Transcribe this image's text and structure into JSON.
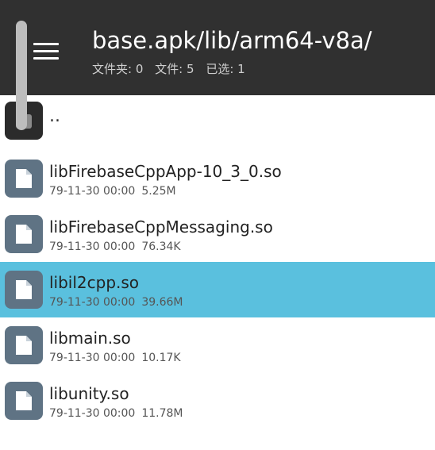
{
  "header": {
    "path": "base.apk/lib/arm64-v8a/",
    "folders_label": "文件夹: 0",
    "files_label": "文件: 5",
    "selected_label": "已选: 1"
  },
  "parent_dir": {
    "name": ".."
  },
  "files": [
    {
      "name": "libFirebaseCppApp-10_3_0.so",
      "date": "79-11-30 00:00",
      "size": "5.25M",
      "selected": false
    },
    {
      "name": "libFirebaseCppMessaging.so",
      "date": "79-11-30 00:00",
      "size": "76.34K",
      "selected": false
    },
    {
      "name": "libil2cpp.so",
      "date": "79-11-30 00:00",
      "size": "39.66M",
      "selected": true
    },
    {
      "name": "libmain.so",
      "date": "79-11-30 00:00",
      "size": "10.17K",
      "selected": false
    },
    {
      "name": "libunity.so",
      "date": "79-11-30 00:00",
      "size": "11.78M",
      "selected": false
    }
  ],
  "icons": {
    "menu": "hamburger-menu-icon",
    "file": "file-icon",
    "parent": "parent-folder-icon"
  },
  "colors": {
    "header_bg": "#303030",
    "selected_row": "#5ac0de",
    "file_icon_bg": "#5f7384"
  }
}
